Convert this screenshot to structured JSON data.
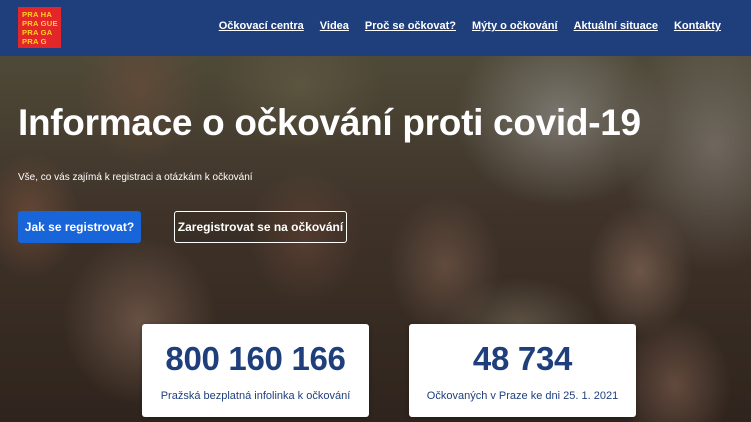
{
  "logo": {
    "lines": [
      "PRA HA",
      "PRA GUE",
      "PRA GA",
      "PRA G"
    ]
  },
  "nav": {
    "items": [
      {
        "label": "Očkovací centra"
      },
      {
        "label": "Videa"
      },
      {
        "label": "Proč se očkovat?"
      },
      {
        "label": "Mýty o očkování"
      },
      {
        "label": "Aktuální situace"
      },
      {
        "label": "Kontakty"
      }
    ]
  },
  "hero": {
    "title": "Informace o očkování proti covid-19",
    "subtitle": "Vše, co vás zajímá k registraci a otázkám k očkování",
    "primary_button": "Jak se registrovat?",
    "secondary_button": "Zaregistrovat se na očkování"
  },
  "cards": [
    {
      "number": "800 160 166",
      "caption": "Pražská bezplatná infolinka k očkování"
    },
    {
      "number": "48 734",
      "caption": "Očkovaných v Praze ke dni 25. 1. 2021"
    }
  ],
  "colors": {
    "header": "#1f3f7c",
    "logo_bg": "#e2262a",
    "logo_text": "#ffd31a",
    "primary_button": "#1864d9",
    "card_text": "#1f3f7c"
  }
}
